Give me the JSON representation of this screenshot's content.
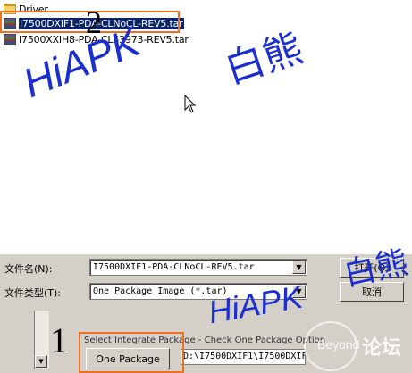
{
  "files": [
    {
      "name": "Driver",
      "icon": "folder-icon"
    },
    {
      "name": "I7500DXIF1-PDA-CLNoCL-REV5.tar",
      "icon": "tar-icon",
      "selected": true
    },
    {
      "name": "I7500XXIH8-PDA-CL53973-REV5.tar",
      "icon": "tar-icon"
    }
  ],
  "dialog": {
    "filename_label": "文件名(N):",
    "filename_value": "I7500DXIF1-PDA-CLNoCL-REV5.tar",
    "filetype_label": "文件类型(T):",
    "filetype_value": "One Package Image (*.tar)",
    "open_button": "打开(O)",
    "cancel_button": "取消"
  },
  "background_app": {
    "group_label": "Select Integrate Package - Check One Package Option",
    "one_package_button": "One Package",
    "path_value": "D:\\I7500DXIF1\\I7500DXIF"
  },
  "annotations": {
    "step1": "1",
    "step2": "2"
  },
  "watermarks": {
    "hiapk": "HiAPK",
    "cn_name": "白熊",
    "site": "论坛",
    "site_sub": "Beyond"
  },
  "colors": {
    "highlight": "#f07020",
    "watermark": "#1b2fd1",
    "selection": "#0a246a"
  }
}
